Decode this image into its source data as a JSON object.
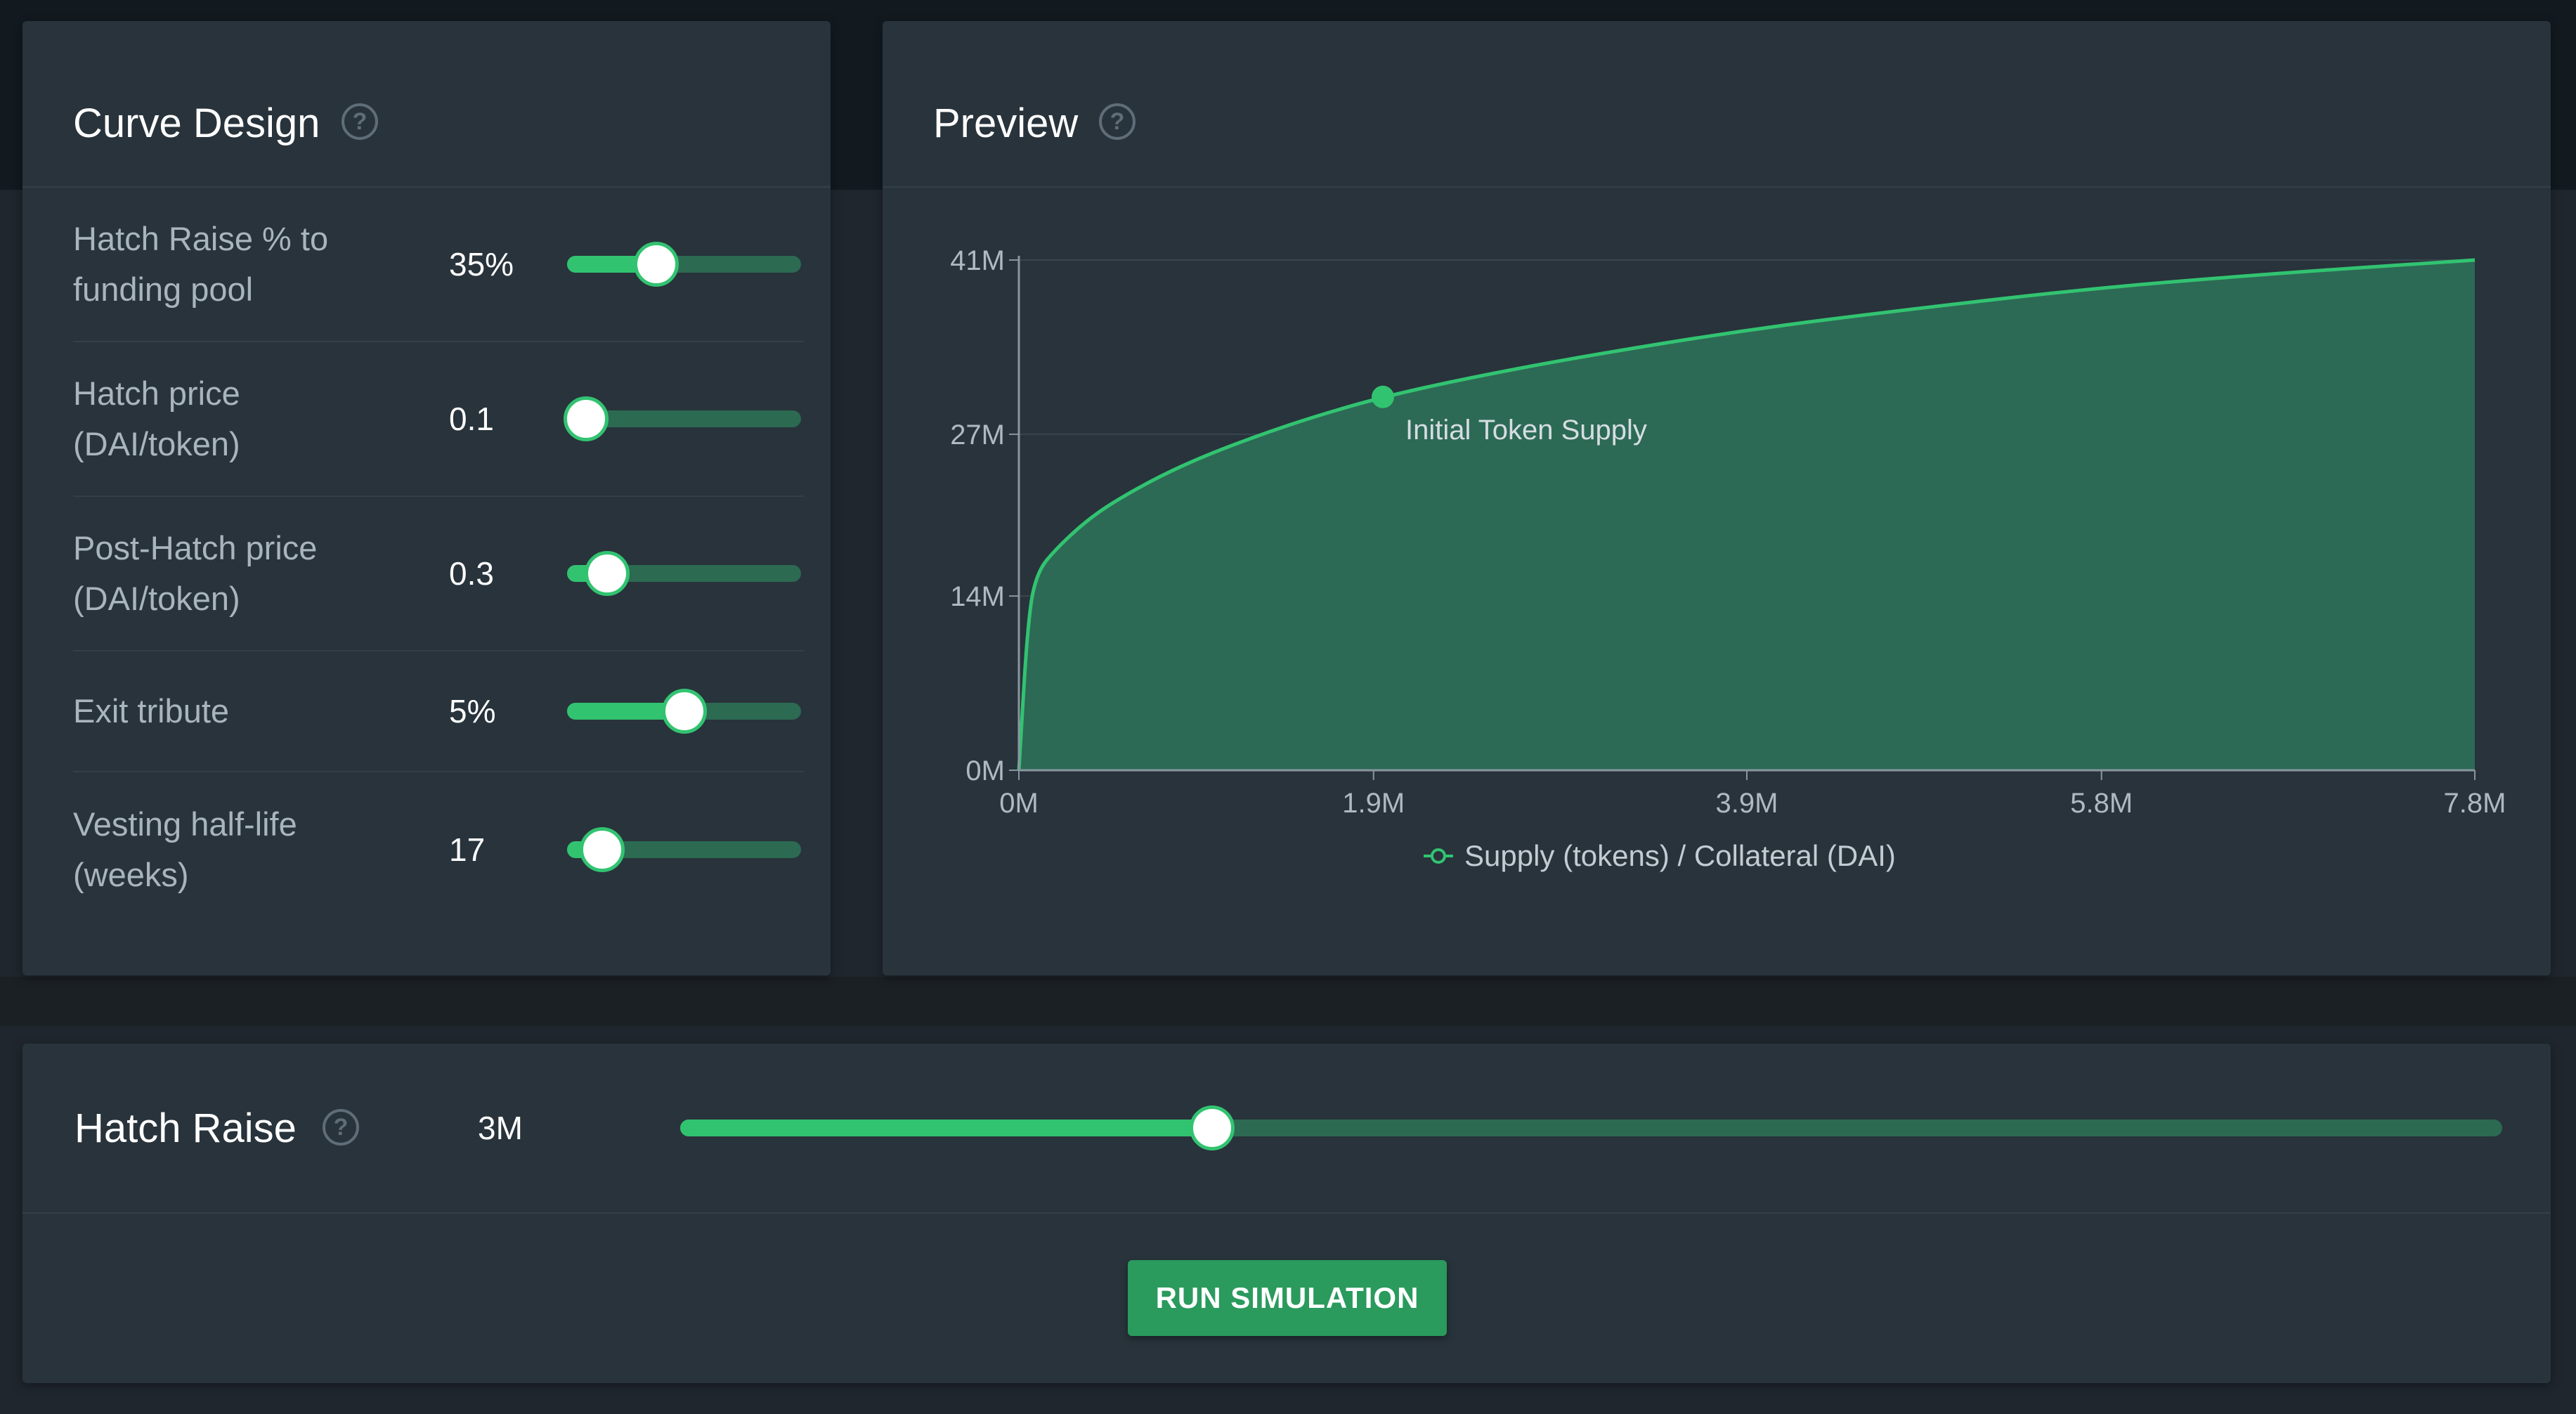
{
  "curve_design": {
    "title": "Curve Design",
    "help_icon": "question-circle-icon",
    "help_glyph": "?",
    "params": [
      {
        "label": "Hatch Raise % to funding pool",
        "value": "35%",
        "slider_fraction": 0.38
      },
      {
        "label": "Hatch price (DAI/token)",
        "value": "0.1",
        "slider_fraction": 0.08
      },
      {
        "label": "Post-Hatch price (DAI/token)",
        "value": "0.3",
        "slider_fraction": 0.17
      },
      {
        "label": "Exit tribute",
        "value": "5%",
        "slider_fraction": 0.5
      },
      {
        "label": "Vesting half-life (weeks)",
        "value": "17",
        "slider_fraction": 0.15
      }
    ]
  },
  "preview": {
    "title": "Preview",
    "help_glyph": "?",
    "annotation": "Initial Token Supply",
    "legend": "Supply (tokens) / Collateral (DAI)"
  },
  "chart_data": {
    "type": "area",
    "x_ticks": [
      "0M",
      "1.9M",
      "3.9M",
      "5.8M",
      "7.8M"
    ],
    "y_ticks": [
      "0M",
      "14M",
      "27M",
      "41M"
    ],
    "xlim": [
      0,
      7.8
    ],
    "ylim": [
      0,
      41
    ],
    "series": [
      {
        "name": "Supply (tokens) / Collateral (DAI)",
        "x": [
          0,
          0.05,
          0.1,
          0.2,
          0.35,
          0.5,
          0.75,
          1.0,
          1.3,
          1.6,
          1.95,
          2.4,
          3.0,
          3.9,
          4.8,
          5.8,
          6.8,
          7.8
        ],
        "y": [
          0,
          12.5,
          16,
          17.8,
          19.9,
          21.5,
          23.6,
          25.3,
          27.0,
          28.5,
          30.0,
          31.5,
          33.2,
          35.4,
          37.1,
          38.8,
          40.0,
          41.0
        ]
      }
    ],
    "marker": {
      "x": 1.95,
      "y": 30.0,
      "label": "Initial Token Supply"
    },
    "colors": {
      "line": "#32c371",
      "area": "#2c6a55",
      "grid": "#39454f"
    },
    "grid": true,
    "legend_position": "bottom"
  },
  "hatch_raise": {
    "title": "Hatch Raise",
    "help_glyph": "?",
    "value": "3M",
    "slider_fraction": 0.292
  },
  "actions": {
    "run_label": "RUN SIMULATION"
  }
}
